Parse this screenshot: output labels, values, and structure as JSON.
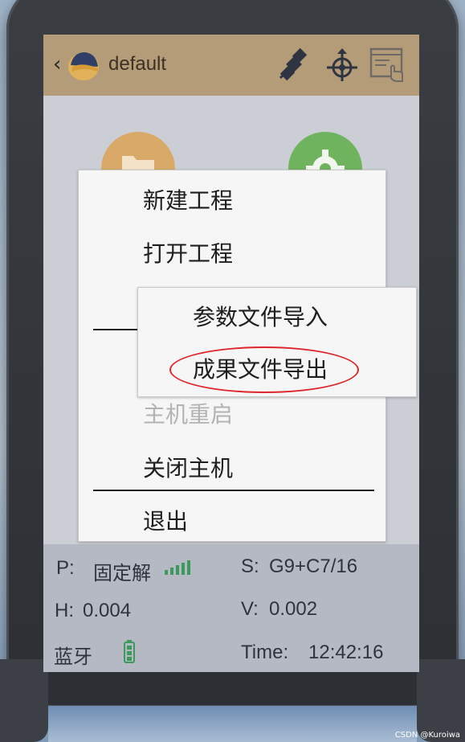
{
  "header": {
    "back_glyph": "‹",
    "title": "default",
    "icons": [
      "satellite-icon",
      "crosshair-icon",
      "window-touch-icon"
    ]
  },
  "menu": {
    "items": [
      {
        "label": "新建工程",
        "enabled": true
      },
      {
        "label": "打开工程",
        "enabled": true
      },
      {
        "label": "主机重启",
        "enabled": false
      },
      {
        "label": "关闭主机",
        "enabled": true
      },
      {
        "label": "退出",
        "enabled": true
      }
    ]
  },
  "submenu": {
    "items": [
      {
        "label": "参数文件导入"
      },
      {
        "label": "成果文件导出",
        "highlighted": true
      }
    ]
  },
  "status": {
    "p_label": "P:",
    "p_value": "固定解",
    "s_label": "S:",
    "s_value": "G9+C7/16",
    "h_label": "H:",
    "h_value": "0.004",
    "v_label": "V:",
    "v_value": "0.002",
    "bt_label": "蓝牙",
    "time_label": "Time:",
    "time_value": "12:42:16",
    "signal_icon": "signal-bars-icon",
    "battery_icon": "battery-icon"
  },
  "colors": {
    "header_bg": "#b59c78",
    "annotation": "#e0262a",
    "folder_circle": "#d9a968",
    "settings_circle": "#6fb35e",
    "signal": "#3e9a5c"
  },
  "watermark": "CSDN @Kuroiwa"
}
